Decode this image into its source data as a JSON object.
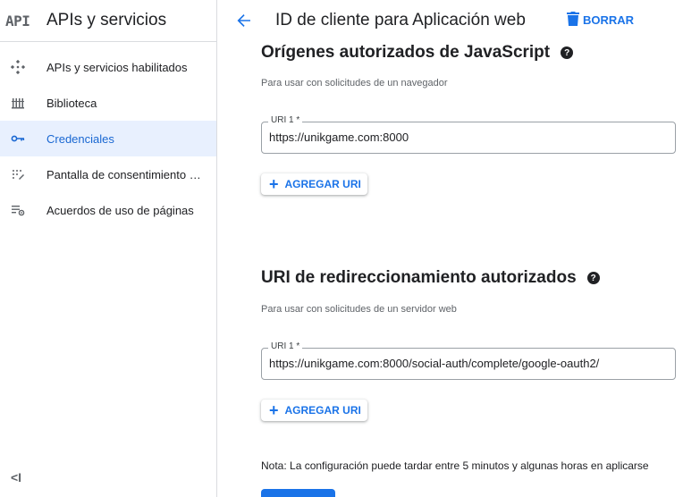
{
  "sidebar": {
    "logo": "API",
    "title": "APIs y servicios",
    "items": [
      {
        "label": "APIs y servicios habilitados",
        "icon": "enabled-apis-icon"
      },
      {
        "label": "Biblioteca",
        "icon": "library-icon"
      },
      {
        "label": "Credenciales",
        "icon": "key-icon",
        "active": true
      },
      {
        "label": "Pantalla de consentimiento …",
        "icon": "consent-screen-icon"
      },
      {
        "label": "Acuerdos de uso de páginas",
        "icon": "page-usage-agreements-icon"
      }
    ],
    "collapse_label": "<I"
  },
  "header": {
    "title": "ID de cliente para Aplicación web",
    "delete_label": "BORRAR"
  },
  "js_origins": {
    "title": "Orígenes autorizados de JavaScript",
    "description": "Para usar con solicitudes de un navegador",
    "uri_label": "URI 1 *",
    "uri_value": "https://unikgame.com:8000",
    "add_label": "AGREGAR URI"
  },
  "redirect_uris": {
    "title": "URI de redireccionamiento autorizados",
    "description": "Para usar con solicitudes de un servidor web",
    "uri_label": "URI 1 *",
    "uri_value": "https://unikgame.com:8000/social-auth/complete/google-oauth2/",
    "add_label": "AGREGAR URI"
  },
  "note": "Nota: La configuración puede tardar entre 5 minutos y algunas horas en aplicarse",
  "colors": {
    "accent": "#1a73e8",
    "active_bg": "#e8f0fe",
    "active_text": "#1967d2"
  }
}
